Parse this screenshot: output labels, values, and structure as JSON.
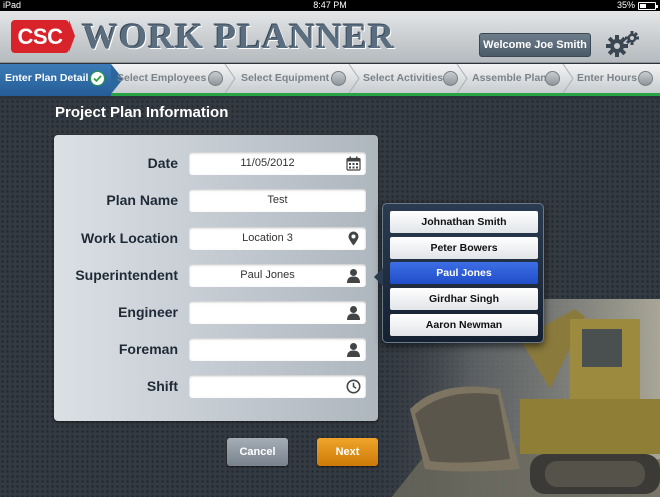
{
  "status_bar": {
    "device": "iPad",
    "time": "8:47 PM",
    "battery": "35%",
    "battery_level": 0.35
  },
  "header": {
    "logo": "CSC",
    "title": "WORK PLANNER",
    "welcome": "Welcome Joe Smith",
    "settings_icon": "gears-icon"
  },
  "steps": [
    {
      "label": "Enter Plan Detail",
      "state": "active-complete"
    },
    {
      "label": "Select Employees",
      "state": "pending"
    },
    {
      "label": "Select Equipment",
      "state": "pending"
    },
    {
      "label": "Select Activities",
      "state": "pending"
    },
    {
      "label": "Assemble Plan",
      "state": "pending"
    },
    {
      "label": "Enter Hours",
      "state": "pending"
    }
  ],
  "section_title": "Project Plan Information",
  "form": {
    "date": {
      "label": "Date",
      "value": "11/05/2012",
      "icon": "calendar-icon"
    },
    "plan_name": {
      "label": "Plan Name",
      "value": "Test"
    },
    "work_location": {
      "label": "Work Location",
      "value": "Location 3",
      "icon": "map-pin-icon"
    },
    "superintendent": {
      "label": "Superintendent",
      "value": "Paul Jones",
      "icon": "person-icon"
    },
    "engineer": {
      "label": "Engineer",
      "value": "",
      "icon": "person-icon"
    },
    "foreman": {
      "label": "Foreman",
      "value": "",
      "icon": "person-icon"
    },
    "shift": {
      "label": "Shift",
      "value": "",
      "icon": "clock-icon"
    }
  },
  "picker": {
    "options": [
      "Johnathan Smith",
      "Peter Bowers",
      "Paul Jones",
      "Girdhar Singh",
      "Aaron Newman"
    ],
    "selected": "Paul Jones"
  },
  "buttons": {
    "cancel": "Cancel",
    "next": "Next"
  },
  "colors": {
    "accent_green": "#27a546",
    "step_active": "#2c669f",
    "next_button": "#e08c14",
    "logo_red": "#d8232a",
    "selected_option": "#2e5dd8"
  }
}
